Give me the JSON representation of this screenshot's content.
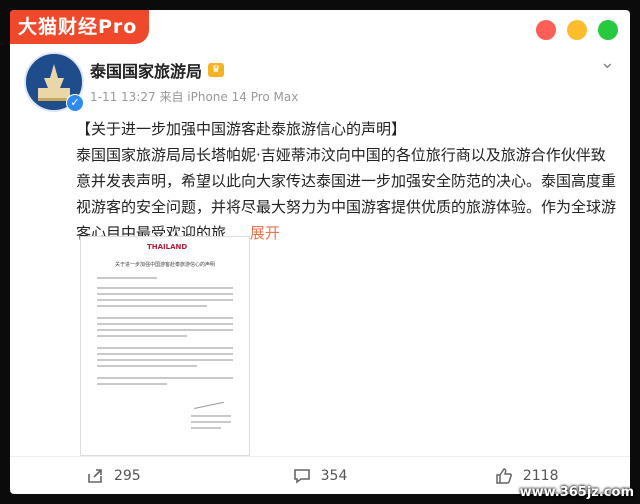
{
  "brand": {
    "label": "大猫财经Pro"
  },
  "window_controls": [
    {
      "name": "close",
      "color": "#ff5f56"
    },
    {
      "name": "minimize",
      "color": "#ffbd2e"
    },
    {
      "name": "maximize",
      "color": "#27c93f"
    }
  ],
  "post": {
    "author": "泰国国家旅游局",
    "time": "1-11 13:27",
    "source": "来自 iPhone 14 Pro Max",
    "title": "【关于进一步加强中国游客赴泰旅游信心的声明】",
    "body": "泰国国家旅游局局长塔帕妮·吉娅蒂沛汶向中国的各位旅行商以及旅游合作伙伴致意并发表声明，希望以此向大家传达泰国进一步加强安全防范的决心。泰国高度重视游客的安全问题，并将尽最大努力为中国游客提供优质的旅游体验。作为全球游客心目中最受欢迎的旅",
    "ellipsis": "...",
    "expand": "展开"
  },
  "document": {
    "logo_text": "THAILAND",
    "title": "关于进一步加强中国游客赴泰旅游信心的声明"
  },
  "actions": {
    "repost_count": "295",
    "comment_count": "354",
    "like_count": "2118"
  },
  "watermark": "www.365jz.com"
}
